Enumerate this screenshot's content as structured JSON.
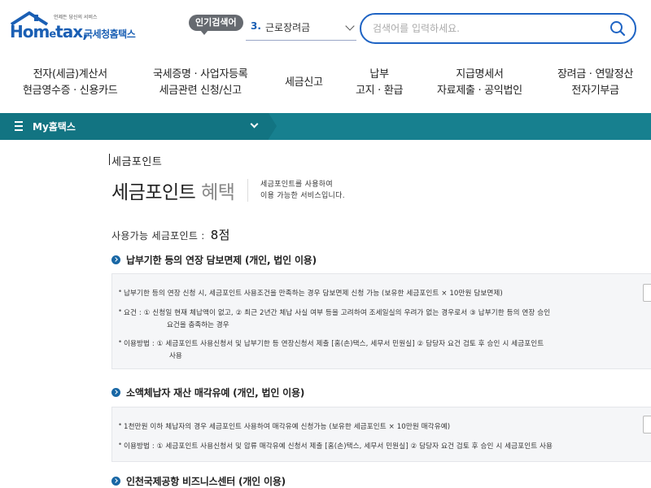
{
  "header": {
    "logo_tagline": "언제든 당신의 서비스",
    "logo_text": "Hometax",
    "logo_korean": "국세청홈택스",
    "popular_label": "인기검색어",
    "popular_rank": "3.",
    "popular_term": "근로장려금",
    "search_placeholder": "검색어를 입력하세요."
  },
  "nav": {
    "items": [
      {
        "line1": "전자(세금)계산서",
        "line2": "현금영수증 · 신용카드"
      },
      {
        "line1": "국세증명 · 사업자등록",
        "line2": "세금관련 신청/신고"
      },
      {
        "line1": "세금신고",
        "line2": ""
      },
      {
        "line1": "납부",
        "line2": "고지 · 환급"
      },
      {
        "line1": "지급명세서",
        "line2": "자료제출 · 공익법인"
      },
      {
        "line1": "장려금 · 연말정산",
        "line2": "전자기부금"
      }
    ]
  },
  "my_bar": {
    "label": "My홈택스"
  },
  "content": {
    "breadcrumb": "세금포인트",
    "title_main": "세금포인트",
    "title_sub": "혜택",
    "desc_line1": "세금포인트를 사용하여",
    "desc_line2": "이용 가능한 서비스입니다.",
    "points_label": "사용가능 세금포인트 :",
    "points_value": "8점",
    "sections": [
      {
        "heading": "납부기한 등의 연장 담보면제 (개인, 법인 이용)",
        "lines": [
          "납부기한 등의 연장 신청 시, 세금포인트 사용조건을 만족하는 경우 담보면제 신청 가능 (보유한 세금포인트 × 10만원 담보면제)",
          "요건 : ① 신청일 현재 체납액이 없고, ② 최근 2년간 체납 사실 여부 등을 고려하여 조세일실의 우려가 없는 경우로서 ③ 납부기한 등의 연장 승인",
          "요건을 충족하는 경우",
          "이용방법 : ① 세금포인트 사용신청서 및 납부기한 등 연장신청서 제출 [홈(손)택스, 세무서 민원실] ② 담당자 요건 검토 후 승인 시 세금포인트",
          "사용"
        ]
      },
      {
        "heading": "소액체납자 재산 매각유예 (개인, 법인 이용)",
        "lines": [
          "1천만원 이하 체납자의 경우 세금포인트 사용하여 매각유예 신청가능 (보유한 세금포인트 × 10만원 매각유예)",
          "이용방법 : ① 세금포인트 사용신청서 및 압류 매각유예 신청서 제출 [홈(손)택스, 세무서 민원실] ② 담당자 요건 검토 후 승인 시 세금포인트 사용"
        ]
      },
      {
        "heading": "인천국제공항 비즈니스센터 (개인 이용)",
        "lines": []
      }
    ]
  },
  "colors": {
    "brand_blue": "#1a5fb4",
    "teal_bar": "#17808f",
    "bullet_blue": "#1867a5"
  },
  "icons": [
    "house-roof-icon",
    "chevron-down-icon",
    "search-icon",
    "menu-icon",
    "circle-arrow-icon"
  ]
}
